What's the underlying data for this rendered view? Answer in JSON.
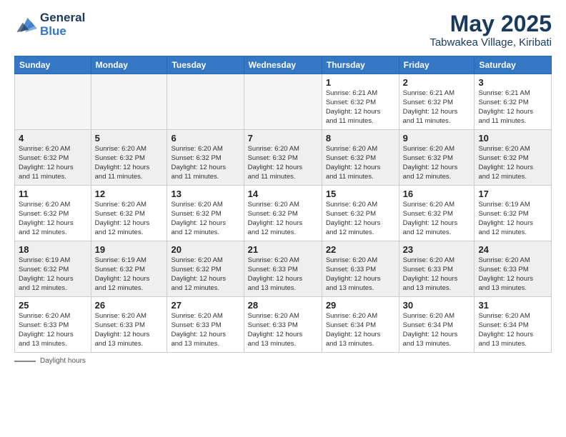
{
  "logo": {
    "line1": "General",
    "line2": "Blue"
  },
  "title": "May 2025",
  "subtitle": "Tabwakea Village, Kiribati",
  "days_of_week": [
    "Sunday",
    "Monday",
    "Tuesday",
    "Wednesday",
    "Thursday",
    "Friday",
    "Saturday"
  ],
  "footer_label": "Daylight hours",
  "weeks": [
    [
      {
        "day": "",
        "info": ""
      },
      {
        "day": "",
        "info": ""
      },
      {
        "day": "",
        "info": ""
      },
      {
        "day": "",
        "info": ""
      },
      {
        "day": "1",
        "info": "Sunrise: 6:21 AM\nSunset: 6:32 PM\nDaylight: 12 hours\nand 11 minutes."
      },
      {
        "day": "2",
        "info": "Sunrise: 6:21 AM\nSunset: 6:32 PM\nDaylight: 12 hours\nand 11 minutes."
      },
      {
        "day": "3",
        "info": "Sunrise: 6:21 AM\nSunset: 6:32 PM\nDaylight: 12 hours\nand 11 minutes."
      }
    ],
    [
      {
        "day": "4",
        "info": "Sunrise: 6:20 AM\nSunset: 6:32 PM\nDaylight: 12 hours\nand 11 minutes."
      },
      {
        "day": "5",
        "info": "Sunrise: 6:20 AM\nSunset: 6:32 PM\nDaylight: 12 hours\nand 11 minutes."
      },
      {
        "day": "6",
        "info": "Sunrise: 6:20 AM\nSunset: 6:32 PM\nDaylight: 12 hours\nand 11 minutes."
      },
      {
        "day": "7",
        "info": "Sunrise: 6:20 AM\nSunset: 6:32 PM\nDaylight: 12 hours\nand 11 minutes."
      },
      {
        "day": "8",
        "info": "Sunrise: 6:20 AM\nSunset: 6:32 PM\nDaylight: 12 hours\nand 11 minutes."
      },
      {
        "day": "9",
        "info": "Sunrise: 6:20 AM\nSunset: 6:32 PM\nDaylight: 12 hours\nand 12 minutes."
      },
      {
        "day": "10",
        "info": "Sunrise: 6:20 AM\nSunset: 6:32 PM\nDaylight: 12 hours\nand 12 minutes."
      }
    ],
    [
      {
        "day": "11",
        "info": "Sunrise: 6:20 AM\nSunset: 6:32 PM\nDaylight: 12 hours\nand 12 minutes."
      },
      {
        "day": "12",
        "info": "Sunrise: 6:20 AM\nSunset: 6:32 PM\nDaylight: 12 hours\nand 12 minutes."
      },
      {
        "day": "13",
        "info": "Sunrise: 6:20 AM\nSunset: 6:32 PM\nDaylight: 12 hours\nand 12 minutes."
      },
      {
        "day": "14",
        "info": "Sunrise: 6:20 AM\nSunset: 6:32 PM\nDaylight: 12 hours\nand 12 minutes."
      },
      {
        "day": "15",
        "info": "Sunrise: 6:20 AM\nSunset: 6:32 PM\nDaylight: 12 hours\nand 12 minutes."
      },
      {
        "day": "16",
        "info": "Sunrise: 6:20 AM\nSunset: 6:32 PM\nDaylight: 12 hours\nand 12 minutes."
      },
      {
        "day": "17",
        "info": "Sunrise: 6:19 AM\nSunset: 6:32 PM\nDaylight: 12 hours\nand 12 minutes."
      }
    ],
    [
      {
        "day": "18",
        "info": "Sunrise: 6:19 AM\nSunset: 6:32 PM\nDaylight: 12 hours\nand 12 minutes."
      },
      {
        "day": "19",
        "info": "Sunrise: 6:19 AM\nSunset: 6:32 PM\nDaylight: 12 hours\nand 12 minutes."
      },
      {
        "day": "20",
        "info": "Sunrise: 6:20 AM\nSunset: 6:32 PM\nDaylight: 12 hours\nand 12 minutes."
      },
      {
        "day": "21",
        "info": "Sunrise: 6:20 AM\nSunset: 6:33 PM\nDaylight: 12 hours\nand 13 minutes."
      },
      {
        "day": "22",
        "info": "Sunrise: 6:20 AM\nSunset: 6:33 PM\nDaylight: 12 hours\nand 13 minutes."
      },
      {
        "day": "23",
        "info": "Sunrise: 6:20 AM\nSunset: 6:33 PM\nDaylight: 12 hours\nand 13 minutes."
      },
      {
        "day": "24",
        "info": "Sunrise: 6:20 AM\nSunset: 6:33 PM\nDaylight: 12 hours\nand 13 minutes."
      }
    ],
    [
      {
        "day": "25",
        "info": "Sunrise: 6:20 AM\nSunset: 6:33 PM\nDaylight: 12 hours\nand 13 minutes."
      },
      {
        "day": "26",
        "info": "Sunrise: 6:20 AM\nSunset: 6:33 PM\nDaylight: 12 hours\nand 13 minutes."
      },
      {
        "day": "27",
        "info": "Sunrise: 6:20 AM\nSunset: 6:33 PM\nDaylight: 12 hours\nand 13 minutes."
      },
      {
        "day": "28",
        "info": "Sunrise: 6:20 AM\nSunset: 6:33 PM\nDaylight: 12 hours\nand 13 minutes."
      },
      {
        "day": "29",
        "info": "Sunrise: 6:20 AM\nSunset: 6:34 PM\nDaylight: 12 hours\nand 13 minutes."
      },
      {
        "day": "30",
        "info": "Sunrise: 6:20 AM\nSunset: 6:34 PM\nDaylight: 12 hours\nand 13 minutes."
      },
      {
        "day": "31",
        "info": "Sunrise: 6:20 AM\nSunset: 6:34 PM\nDaylight: 12 hours\nand 13 minutes."
      }
    ]
  ]
}
